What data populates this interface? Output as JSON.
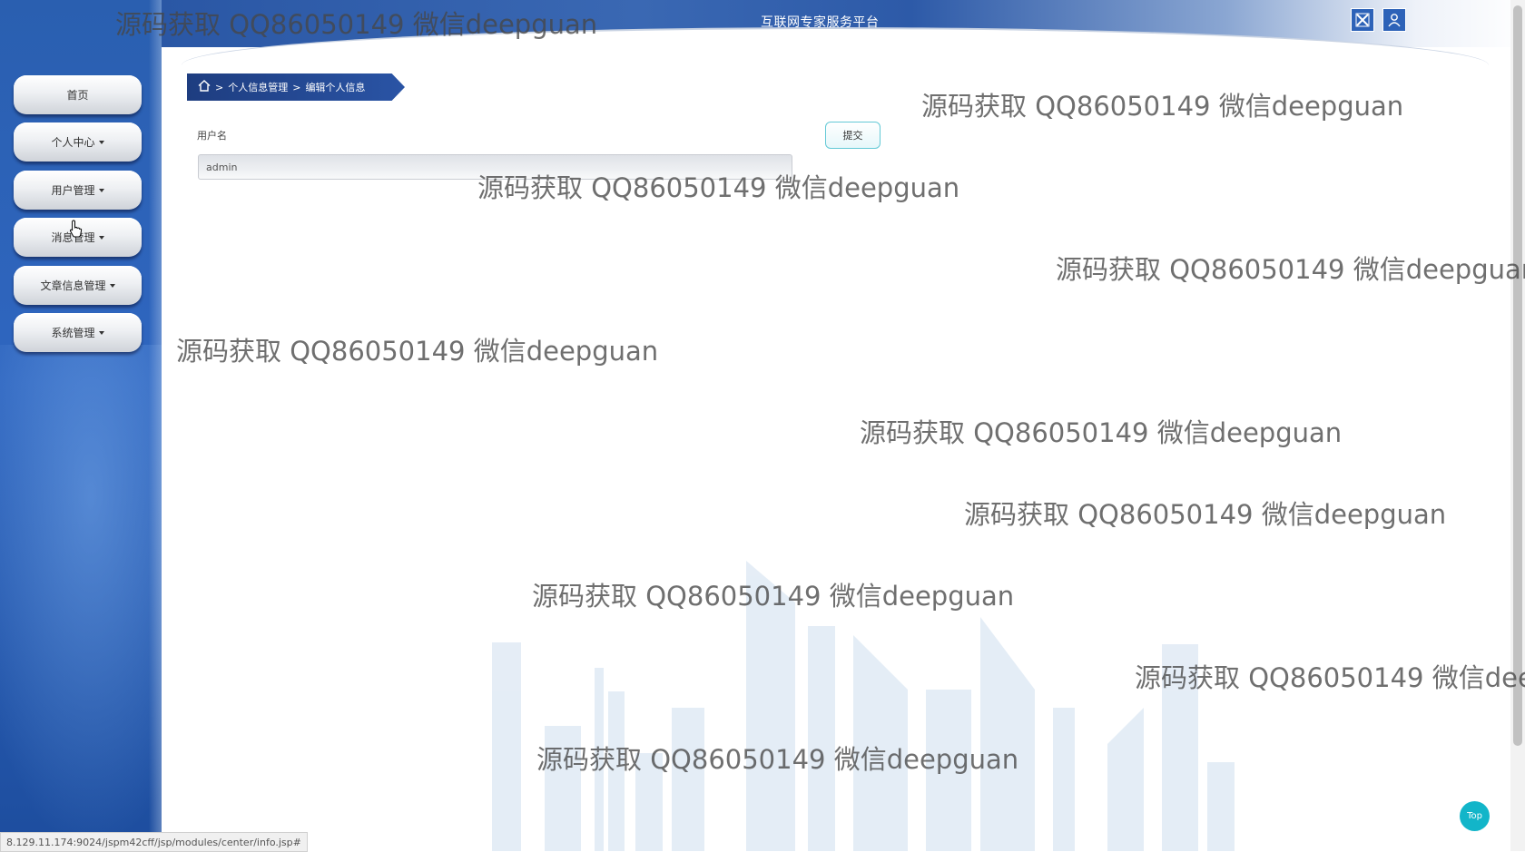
{
  "header": {
    "title": "互联网专家服务平台",
    "icons": [
      "fullscreen-icon",
      "user-icon"
    ]
  },
  "sidebar": {
    "items": [
      {
        "label": "首页",
        "dropdown": false
      },
      {
        "label": "个人中心",
        "dropdown": true
      },
      {
        "label": "用户管理",
        "dropdown": true
      },
      {
        "label": "消息管理",
        "dropdown": true
      },
      {
        "label": "文章信息管理",
        "dropdown": true
      },
      {
        "label": "系统管理",
        "dropdown": true
      }
    ]
  },
  "breadcrumb": {
    "home_icon": "home-icon",
    "sep": ">",
    "level1": "个人信息管理",
    "level2": "编辑个人信息"
  },
  "form": {
    "username_label": "用户名",
    "username_value": "admin",
    "submit_label": "提交"
  },
  "watermark": "源码获取 QQ86050149 微信deepguan",
  "status_url": "8.129.11.174:9024/jspm42cff/jsp/modules/center/info.jsp#",
  "top_button": "Top",
  "colors": {
    "sidebar": "#2f66c0",
    "breadcrumb": "#1e3d80",
    "accent": "#12b5c9"
  }
}
